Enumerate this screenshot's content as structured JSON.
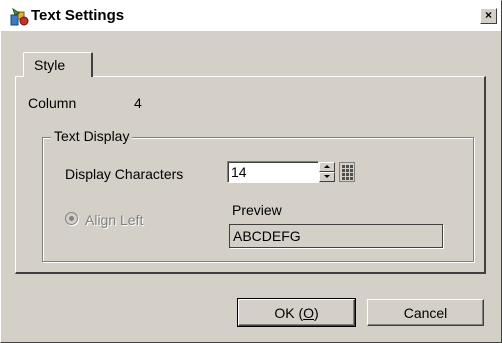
{
  "window": {
    "title": "Text Settings",
    "close_glyph": "×"
  },
  "tabs": [
    {
      "label": "Style",
      "active": true
    }
  ],
  "style_panel": {
    "column_label": "Column",
    "column_value": "4",
    "group_title": "Text Display",
    "display_characters_label": "Display Characters",
    "display_characters_value": "14",
    "align_label": "Align Left",
    "align_selected": true,
    "align_enabled": false,
    "preview_label": "Preview",
    "preview_value": "ABCDEFG"
  },
  "buttons": {
    "ok_label": "OK (O)",
    "ok_mnemonic": "O",
    "cancel_label": "Cancel"
  },
  "icons": {
    "title_icon": "text-settings-icon",
    "spin": "spinner-arrows-icon",
    "keypad": "numeric-keypad-icon"
  },
  "colors": {
    "face": "#d4d0c8",
    "disabled_text": "#808080"
  }
}
